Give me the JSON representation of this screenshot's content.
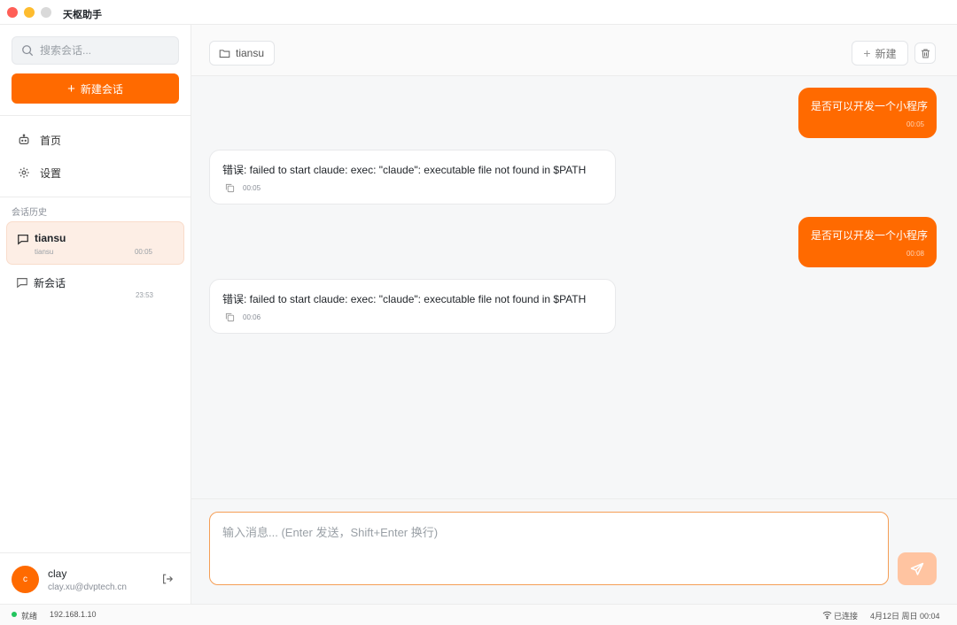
{
  "app": {
    "title": "天枢助手"
  },
  "sidebar": {
    "search_placeholder": "搜索会话...",
    "new_chat_label": "新建会话",
    "nav": [
      {
        "label": "首页",
        "icon": "robot-icon"
      },
      {
        "label": "设置",
        "icon": "gear-icon"
      }
    ],
    "history_label": "会话历史",
    "conversations": [
      {
        "name": "tiansu",
        "subtitle": "tiansu",
        "time": "00:05",
        "active": true
      },
      {
        "name": "新会话",
        "subtitle": "",
        "time": "23:53",
        "active": false
      }
    ],
    "user": {
      "initial": "c",
      "name": "clay",
      "email": "clay.xu@dvptech.cn"
    }
  },
  "main": {
    "folder_label": "tiansu",
    "new_button_label": "新建",
    "messages": [
      {
        "role": "user",
        "text": "是否可以开发一个小程序",
        "time": "00:05"
      },
      {
        "role": "assistant",
        "text": "错误: failed to start claude: exec: \"claude\": executable file not found in $PATH",
        "time": "00:05"
      },
      {
        "role": "user",
        "text": "是否可以开发一个小程序",
        "time": "00:08"
      },
      {
        "role": "assistant",
        "text": "错误: failed to start claude: exec: \"claude\": executable file not found in $PATH",
        "time": "00:06"
      }
    ],
    "composer_placeholder": "输入消息... (Enter 发送，Shift+Enter 换行)"
  },
  "statusbar": {
    "status": "就绪",
    "ip": "192.168.1.10",
    "connection": "已连接",
    "datetime": "4月12日 周日 00:04"
  },
  "colors": {
    "accent": "#ff6a00",
    "accent_light": "#ffc4a1",
    "active_bg": "#fdeee5",
    "status_ok": "#22c55e"
  }
}
